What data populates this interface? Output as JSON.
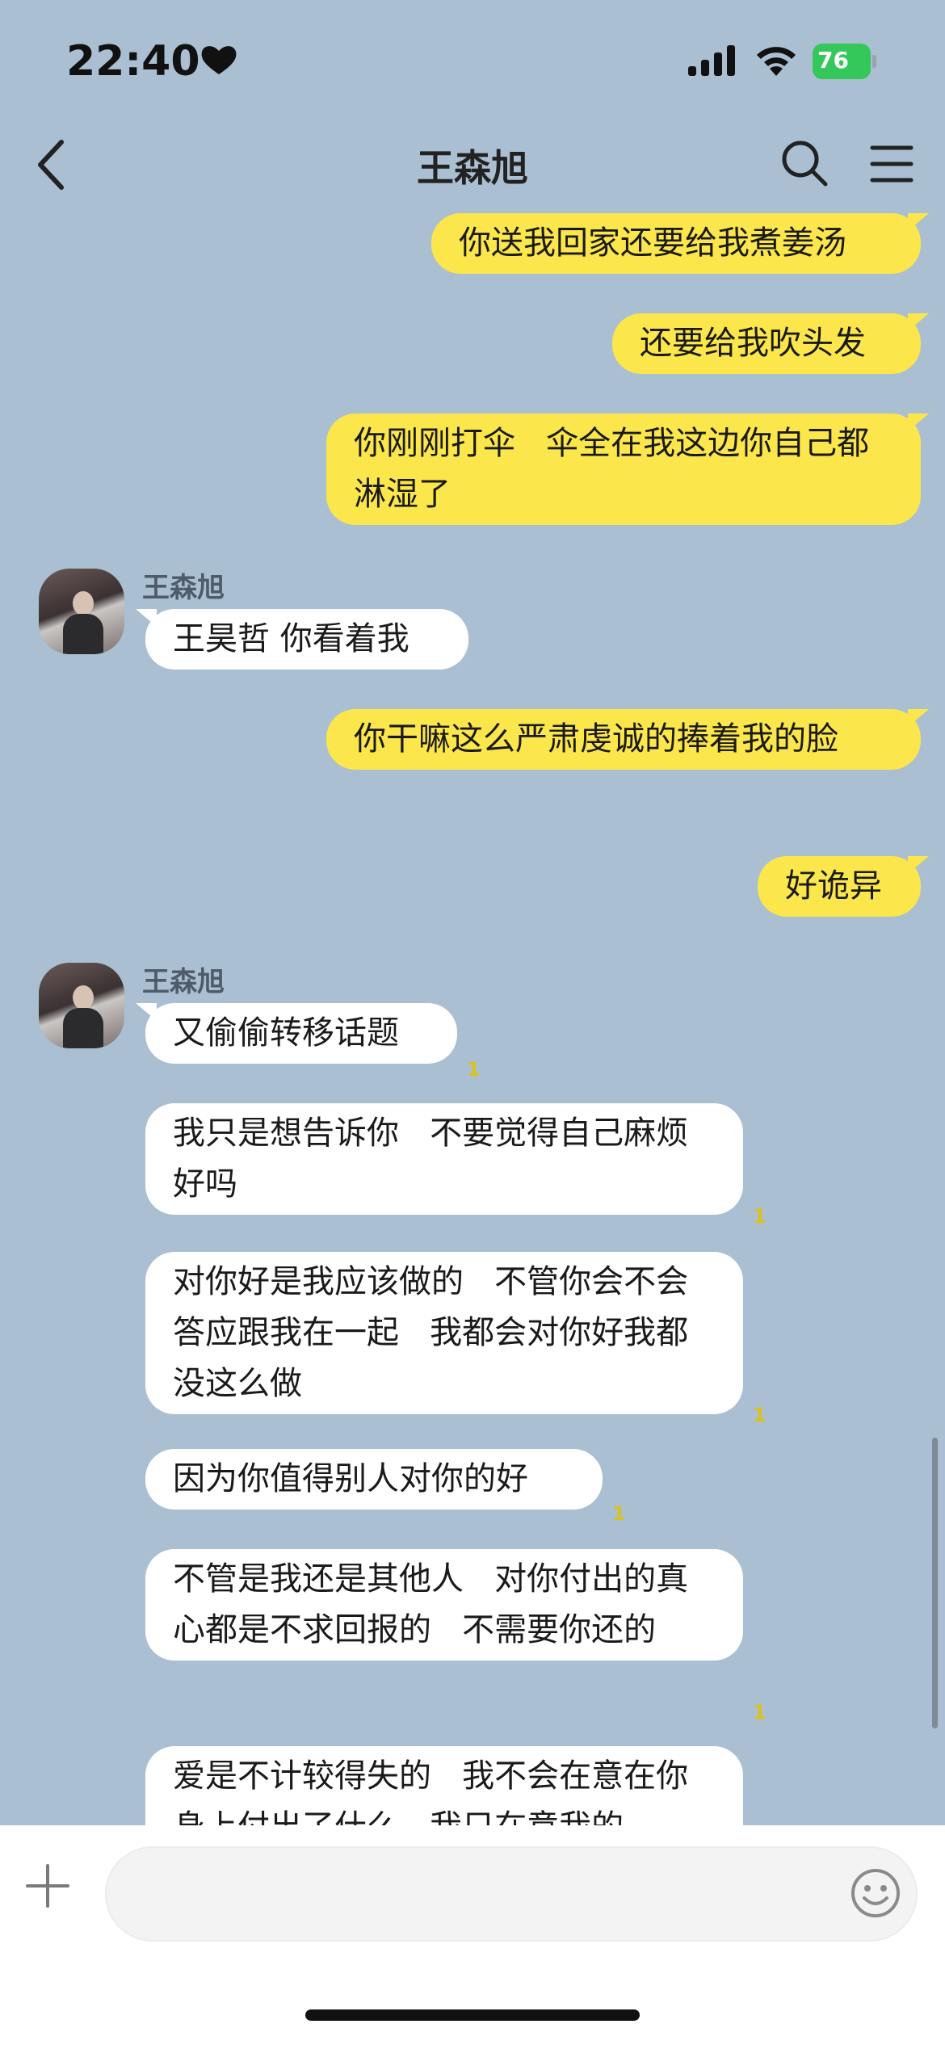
{
  "status": {
    "time": "22:40",
    "battery": "76"
  },
  "header": {
    "title": "王森旭"
  },
  "messages": [
    {
      "text": "你送我回家还要给我煮姜汤"
    },
    {
      "text": "还要给我吹头发"
    },
    {
      "text": "你刚刚打伞   伞全在我这边你自己都淋湿了"
    },
    {
      "sender": "王森旭",
      "text": "王昊哲 你看着我"
    },
    {
      "text": "你干嘛这么严肃虔诚的捧着我的脸"
    },
    {
      "text": "好诡异"
    },
    {
      "sender": "王森旭",
      "text": "又偷偷转移话题",
      "read": "1"
    },
    {
      "text": "我只是想告诉你   不要觉得自己麻烦好吗",
      "read": "1"
    },
    {
      "text": "对你好是我应该做的   不管你会不会答应跟我在一起   我都会对你好我都没这么做",
      "read": "1"
    },
    {
      "text": "因为你值得别人对你的好",
      "read": "1"
    },
    {
      "text": "不管是我还是其他人   对你付出的真心都是不求回报的   不需要你还的",
      "read": "1"
    },
    {
      "text": "爱是不计较得失的   我不会在意在你身上付出了什么   我只在意我的"
    }
  ],
  "input": {
    "placeholder": ""
  },
  "colors": {
    "background": "#abbfd2",
    "outgoing": "#fbe64b",
    "incoming": "#ffffff",
    "read_mark": "#d9c21a"
  },
  "icons": [
    "back-chevron-icon",
    "search-icon",
    "menu-icon",
    "plus-icon",
    "emoji-icon",
    "heart-icon",
    "signal-icon",
    "wifi-icon",
    "battery-icon"
  ]
}
